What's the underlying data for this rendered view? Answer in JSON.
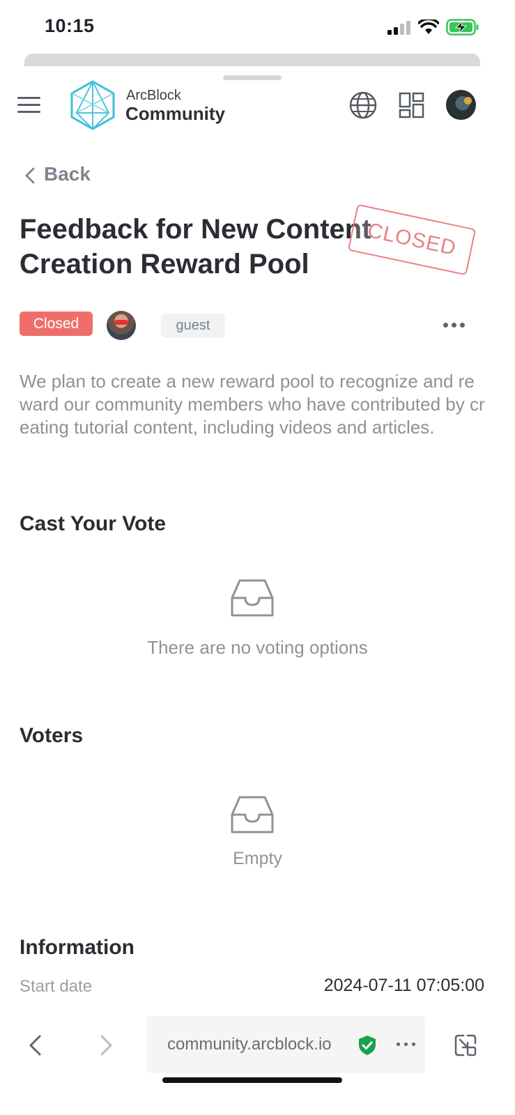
{
  "status_bar": {
    "time": "10:15"
  },
  "header": {
    "brand_top": "ArcBlock",
    "brand_bottom": "Community",
    "icons": [
      "menu-icon",
      "globe-icon",
      "apps-grid-icon",
      "user-avatar"
    ]
  },
  "nav": {
    "back_label": "Back"
  },
  "post": {
    "title": "Feedback for New Content Creation Reward Pool",
    "stamp_text": "CLOSED",
    "status_badge": "Closed",
    "author_tag": "guest",
    "description": "We plan to create a new reward pool to recognize and reward our community members who have contributed by creating tutorial content, including videos and articles."
  },
  "vote_section": {
    "heading": "Cast Your Vote",
    "empty_text": "There are no voting options"
  },
  "voters_section": {
    "heading": "Voters",
    "empty_text": "Empty"
  },
  "info_section": {
    "heading": "Information",
    "start_date_label": "Start date",
    "start_date_value": "2024-07-11 07:05:00"
  },
  "browser_bar": {
    "url": "community.arcblock.io"
  },
  "colors": {
    "accent_red": "#ee6e6c",
    "secure_green": "#1aa14a",
    "logo_cyan": "#3fbfd9"
  }
}
